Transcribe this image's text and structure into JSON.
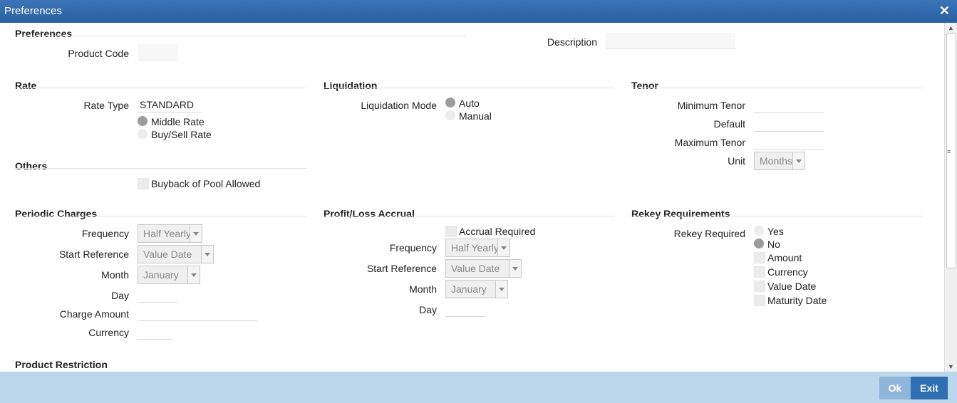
{
  "window": {
    "title": "Preferences",
    "close_glyph": "✕"
  },
  "preferences": {
    "heading": "Preferences",
    "product_code_label": "Product Code",
    "product_code": "",
    "description_label": "Description",
    "description": ""
  },
  "rate": {
    "heading": "Rate",
    "rate_type_label": "Rate Type",
    "rate_type": "STANDARD",
    "options": [
      "Middle Rate",
      "Buy/Sell Rate"
    ],
    "selected": "Middle Rate"
  },
  "liquidation": {
    "heading": "Liquidation",
    "mode_label": "Liquidation Mode",
    "options": [
      "Auto",
      "Manual"
    ],
    "selected": "Auto"
  },
  "tenor": {
    "heading": "Tenor",
    "min_label": "Minimum Tenor",
    "default_label": "Default",
    "max_label": "Maximum Tenor",
    "unit_label": "Unit",
    "unit": "Months"
  },
  "others": {
    "heading": "Others",
    "buyback_label": "Buyback of Pool Allowed"
  },
  "periodic_charges": {
    "heading": "Periodic Charges",
    "frequency_label": "Frequency",
    "frequency": "Half Yearly",
    "start_reference_label": "Start Reference",
    "start_reference": "Value Date",
    "month_label": "Month",
    "month": "January",
    "day_label": "Day",
    "charge_amount_label": "Charge Amount",
    "currency_label": "Currency"
  },
  "profit_loss_accrual": {
    "heading": "Profit/Loss Accrual",
    "accrual_required_label": "Accrual Required",
    "frequency_label": "Frequency",
    "frequency": "Half Yearly",
    "start_reference_label": "Start Reference",
    "start_reference": "Value Date",
    "month_label": "Month",
    "month": "January",
    "day_label": "Day"
  },
  "rekey": {
    "heading": "Rekey Requirements",
    "required_label": "Rekey Required",
    "options": [
      "Yes",
      "No"
    ],
    "selected": "No",
    "fields": [
      "Amount",
      "Currency",
      "Value Date",
      "Maturity Date"
    ]
  },
  "product_restriction": {
    "heading": "Product Restriction"
  },
  "footer": {
    "ok_label": "Ok",
    "exit_label": "Exit"
  }
}
